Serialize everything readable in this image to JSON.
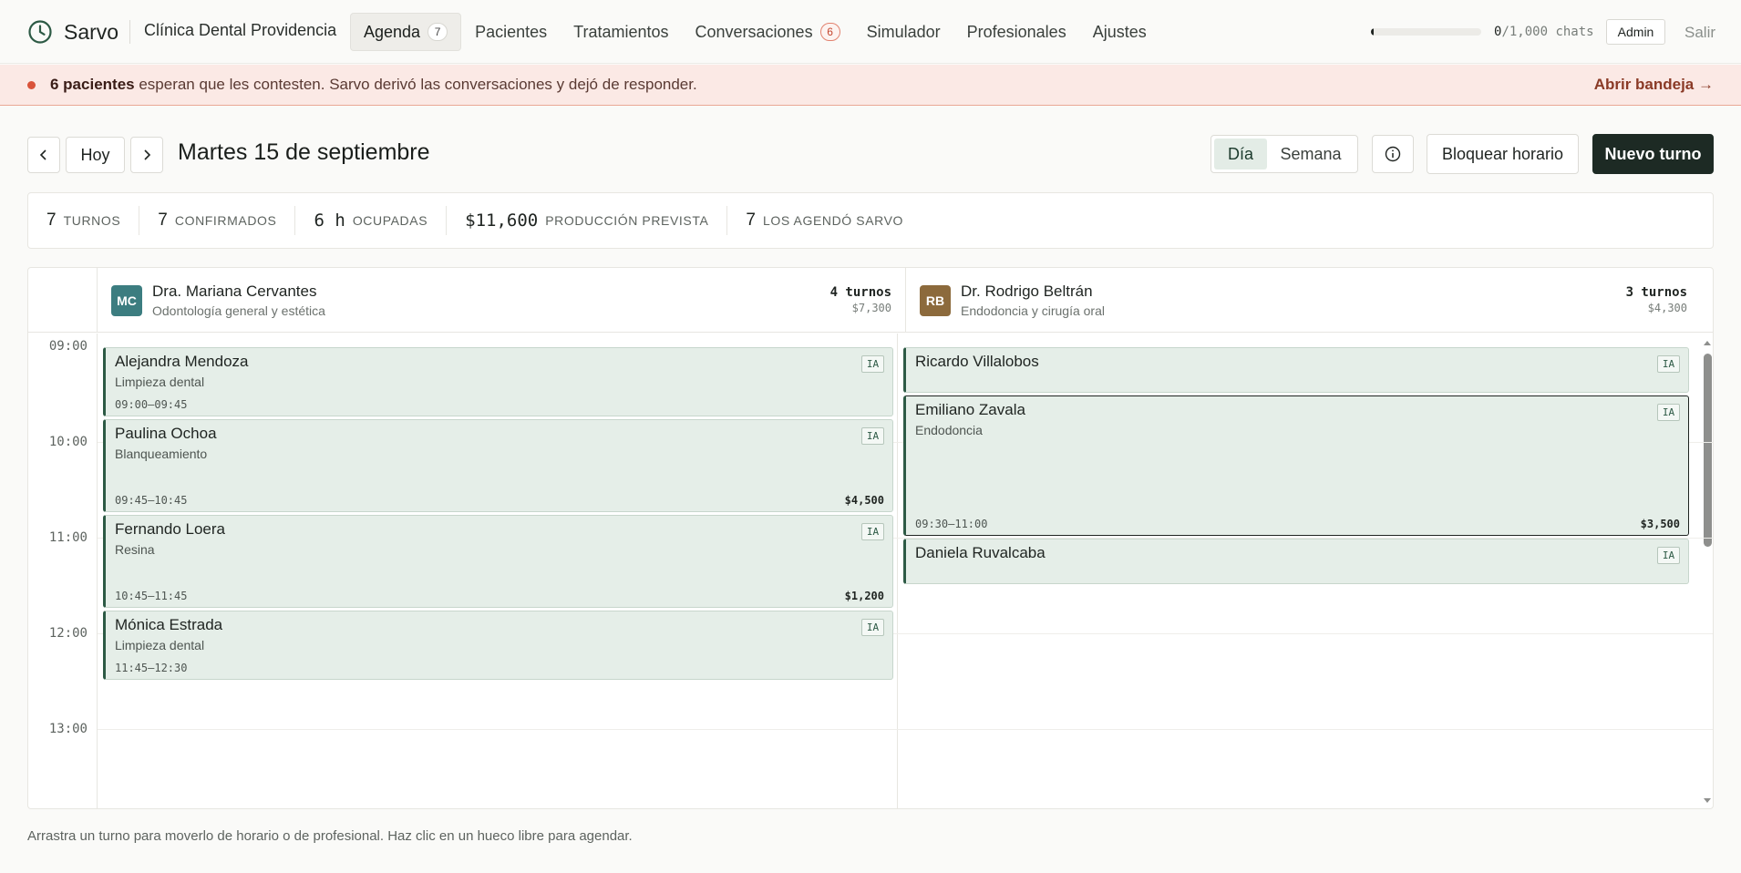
{
  "brand": {
    "name": "Sarvo",
    "clinic": "Clínica Dental Providencia"
  },
  "nav": [
    {
      "label": "Agenda",
      "badge": "7",
      "active": true,
      "alert": false
    },
    {
      "label": "Pacientes",
      "badge": null,
      "active": false,
      "alert": false
    },
    {
      "label": "Tratamientos",
      "badge": null,
      "active": false,
      "alert": false
    },
    {
      "label": "Conversaciones",
      "badge": "6",
      "active": false,
      "alert": true
    },
    {
      "label": "Simulador",
      "badge": null,
      "active": false,
      "alert": false
    },
    {
      "label": "Profesionales",
      "badge": null,
      "active": false,
      "alert": false
    },
    {
      "label": "Ajustes",
      "badge": null,
      "active": false,
      "alert": false
    }
  ],
  "usage": {
    "used": "0",
    "rest": "/1,000 chats",
    "fraction": 0.01
  },
  "user": {
    "role": "Admin",
    "logout": "Salir"
  },
  "banner": {
    "strong": "6 pacientes",
    "text": " esperan que les contesten. Sarvo derivó las conversaciones y dejó de responder.",
    "link": "Abrir bandeja →"
  },
  "toolbar": {
    "today": "Hoy",
    "date": "Martes 15 de septiembre",
    "views": [
      {
        "label": "Día",
        "active": true
      },
      {
        "label": "Semana",
        "active": false
      }
    ],
    "block": "Bloquear horario",
    "new": "Nuevo turno"
  },
  "stats": [
    {
      "value": "7",
      "label": "turnos",
      "mono": false
    },
    {
      "value": "7",
      "label": "confirmados",
      "mono": false
    },
    {
      "value": "6 h",
      "label": "ocupadas",
      "mono": true
    },
    {
      "value": "$11,600",
      "label": "producción prevista",
      "mono": true
    },
    {
      "value": "7",
      "label": "los agendó Sarvo",
      "mono": false
    }
  ],
  "hours": [
    "09:00",
    "10:00",
    "11:00",
    "12:00",
    "13:00"
  ],
  "professionals": [
    {
      "initials": "MC",
      "color": "#3c7d80",
      "name": "Dra. Mariana Cervantes",
      "spec": "Odontología general y estética",
      "count": "4 turnos",
      "amount": "$7,300",
      "appointments": [
        {
          "name": "Alejandra Mendoza",
          "treatment": "Limpieza dental",
          "time": "09:00–09:45",
          "price": "",
          "ia": "IA",
          "start": 9.0,
          "end": 9.75,
          "selected": false
        },
        {
          "name": "Paulina Ochoa",
          "treatment": "Blanqueamiento",
          "time": "09:45–10:45",
          "price": "$4,500",
          "ia": "IA",
          "start": 9.75,
          "end": 10.75,
          "selected": false
        },
        {
          "name": "Fernando Loera",
          "treatment": "Resina",
          "time": "10:45–11:45",
          "price": "$1,200",
          "ia": "IA",
          "start": 10.75,
          "end": 11.75,
          "selected": false
        },
        {
          "name": "Mónica Estrada",
          "treatment": "Limpieza dental",
          "time": "11:45–12:30",
          "price": "",
          "ia": "IA",
          "start": 11.75,
          "end": 12.5,
          "selected": false
        }
      ]
    },
    {
      "initials": "RB",
      "color": "#8c6a3c",
      "name": "Dr. Rodrigo Beltrán",
      "spec": "Endodoncia y cirugía oral",
      "count": "3 turnos",
      "amount": "$4,300",
      "appointments": [
        {
          "name": "Ricardo Villalobos",
          "treatment": "",
          "time": "",
          "price": "",
          "ia": "IA",
          "start": 9.0,
          "end": 9.5,
          "selected": false
        },
        {
          "name": "Emiliano Zavala",
          "treatment": "Endodoncia",
          "time": "09:30–11:00",
          "price": "$3,500",
          "ia": "IA",
          "start": 9.5,
          "end": 11.0,
          "selected": true
        },
        {
          "name": "Daniela Ruvalcaba",
          "treatment": "",
          "time": "",
          "price": "",
          "ia": "IA",
          "start": 11.0,
          "end": 11.5,
          "selected": false
        }
      ]
    }
  ],
  "hint": "Arrastra un turno para moverlo de horario o de profesional. Haz clic en un hueco libre para agendar."
}
